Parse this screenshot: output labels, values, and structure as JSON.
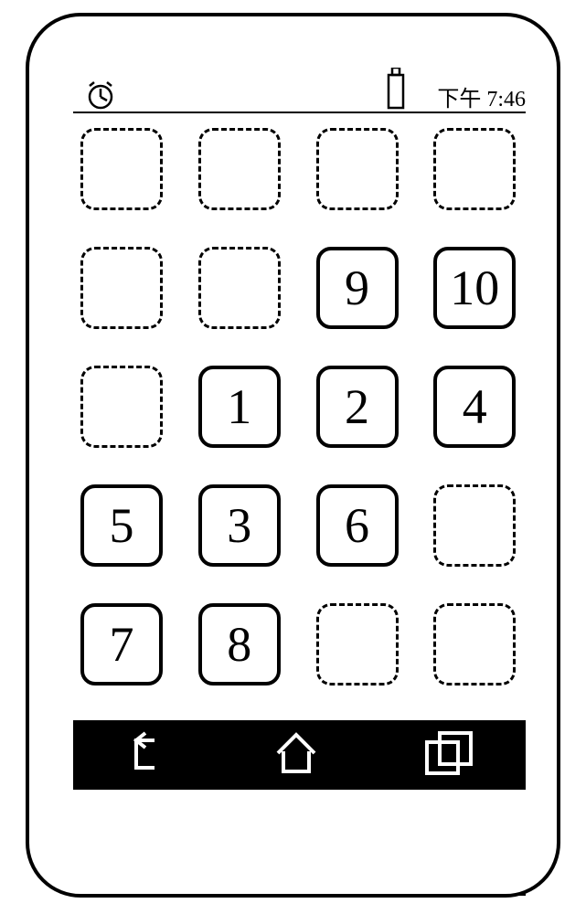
{
  "status": {
    "time": "下午  7:46"
  },
  "grid": {
    "rows": 5,
    "cols": 4,
    "cells": [
      {
        "r": 0,
        "c": 0,
        "type": "empty",
        "label": ""
      },
      {
        "r": 0,
        "c": 1,
        "type": "empty",
        "label": ""
      },
      {
        "r": 0,
        "c": 2,
        "type": "empty",
        "label": ""
      },
      {
        "r": 0,
        "c": 3,
        "type": "empty",
        "label": ""
      },
      {
        "r": 1,
        "c": 0,
        "type": "empty",
        "label": ""
      },
      {
        "r": 1,
        "c": 1,
        "type": "empty",
        "label": ""
      },
      {
        "r": 1,
        "c": 2,
        "type": "solid",
        "label": "9"
      },
      {
        "r": 1,
        "c": 3,
        "type": "solid",
        "label": "10"
      },
      {
        "r": 2,
        "c": 0,
        "type": "empty",
        "label": ""
      },
      {
        "r": 2,
        "c": 1,
        "type": "solid",
        "label": "1"
      },
      {
        "r": 2,
        "c": 2,
        "type": "solid",
        "label": "2"
      },
      {
        "r": 2,
        "c": 3,
        "type": "solid",
        "label": "4"
      },
      {
        "r": 3,
        "c": 0,
        "type": "solid",
        "label": "5"
      },
      {
        "r": 3,
        "c": 1,
        "type": "solid",
        "label": "3"
      },
      {
        "r": 3,
        "c": 2,
        "type": "solid",
        "label": "6"
      },
      {
        "r": 3,
        "c": 3,
        "type": "empty",
        "label": ""
      },
      {
        "r": 4,
        "c": 0,
        "type": "solid",
        "label": "7"
      },
      {
        "r": 4,
        "c": 1,
        "type": "solid",
        "label": "8"
      },
      {
        "r": 4,
        "c": 2,
        "type": "empty",
        "label": ""
      },
      {
        "r": 4,
        "c": 3,
        "type": "empty",
        "label": ""
      }
    ]
  },
  "nav": {
    "back": "back-icon",
    "home": "home-icon",
    "recent": "recent-icon"
  }
}
